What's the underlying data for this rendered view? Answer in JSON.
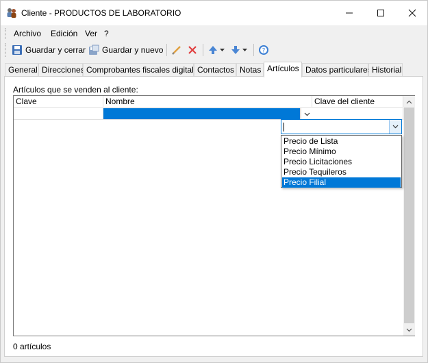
{
  "window": {
    "title": "Cliente - PRODUCTOS DE LABORATORIO",
    "controls": {
      "minimize": "—",
      "maximize": "☐",
      "close": "✕"
    }
  },
  "menu": {
    "items": [
      "Archivo",
      "Edición",
      "Ver",
      "?"
    ]
  },
  "toolbar": {
    "save_close_label": "Guardar y cerrar",
    "save_new_label": "Guardar y nuevo"
  },
  "tabs": {
    "items": [
      "General",
      "Direcciones",
      "Comprobantes fiscales digitales",
      "Contactos",
      "Notas",
      "Artículos",
      "Datos particulares",
      "Historial"
    ],
    "active": "Artículos"
  },
  "articulos": {
    "label": "Artículos que se venden al cliente:",
    "columns": [
      "Clave",
      "Nombre",
      "Clave del cliente"
    ],
    "combo_value": "",
    "options": [
      "Precio de Lista",
      "Precio Mínimo",
      "Precio Licitaciones",
      "Precio Tequileros",
      "Precio Filial"
    ],
    "selected_option": "Precio Filial",
    "count_text": "0 artículos"
  },
  "colors": {
    "accent": "#0078d7",
    "window_bg": "#f0f0f0",
    "panel_bg": "#ffffff"
  },
  "icons": [
    "client-app-icon",
    "save-icon",
    "save-new-icon",
    "edit-pencil-icon",
    "delete-x-icon",
    "arrow-up-icon",
    "arrow-down-icon",
    "help-icon"
  ]
}
